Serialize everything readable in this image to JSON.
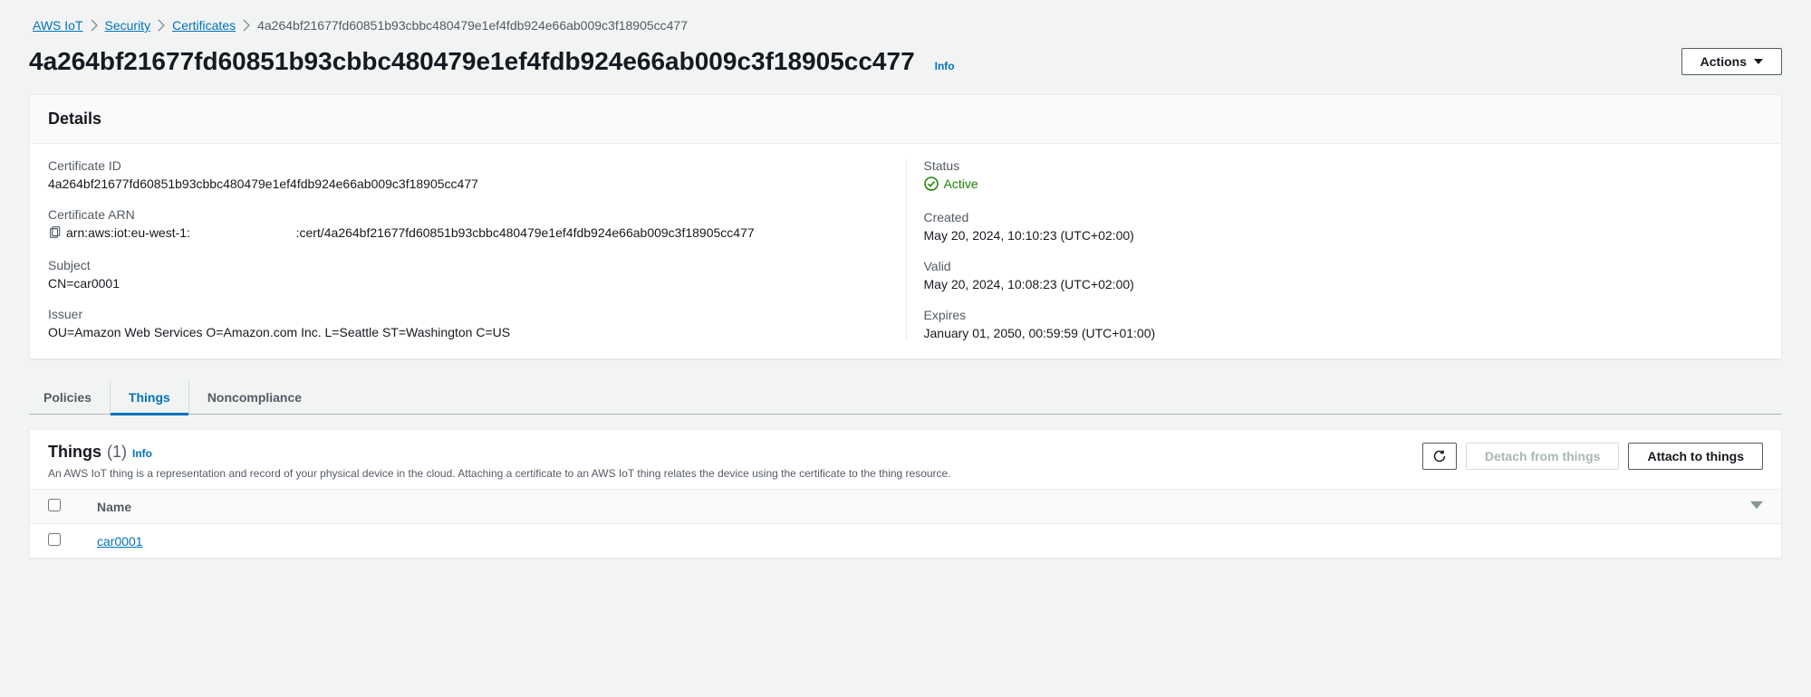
{
  "breadcrumb": {
    "items": [
      {
        "label": "AWS IoT"
      },
      {
        "label": "Security"
      },
      {
        "label": "Certificates"
      }
    ],
    "current": "4a264bf21677fd60851b93cbbc480479e1ef4fdb924e66ab009c3f18905cc477"
  },
  "title": {
    "text": "4a264bf21677fd60851b93cbbc480479e1ef4fdb924e66ab009c3f18905cc477",
    "info_label": "Info",
    "actions_label": "Actions"
  },
  "details": {
    "header": "Details",
    "left": {
      "certificate_id_label": "Certificate ID",
      "certificate_id_value": "4a264bf21677fd60851b93cbbc480479e1ef4fdb924e66ab009c3f18905cc477",
      "certificate_arn_label": "Certificate ARN",
      "certificate_arn_value": "arn:aws:iot:eu-west-1:                              :cert/4a264bf21677fd60851b93cbbc480479e1ef4fdb924e66ab009c3f18905cc477",
      "subject_label": "Subject",
      "subject_value": "CN=car0001",
      "issuer_label": "Issuer",
      "issuer_value": "OU=Amazon Web Services O=Amazon.com Inc. L=Seattle ST=Washington C=US"
    },
    "right": {
      "status_label": "Status",
      "status_value": "Active",
      "created_label": "Created",
      "created_value": "May 20, 2024, 10:10:23 (UTC+02:00)",
      "valid_label": "Valid",
      "valid_value": "May 20, 2024, 10:08:23 (UTC+02:00)",
      "expires_label": "Expires",
      "expires_value": "January 01, 2050, 00:59:59 (UTC+01:00)"
    }
  },
  "tabs": {
    "policies": "Policies",
    "things": "Things",
    "noncompliance": "Noncompliance"
  },
  "things": {
    "title": "Things",
    "count": "(1)",
    "info_label": "Info",
    "description": "An AWS IoT thing is a representation and record of your physical device in the cloud. Attaching a certificate to an AWS IoT thing relates the device using the certificate to the thing resource.",
    "refresh_label": "Refresh",
    "detach_label": "Detach from things",
    "attach_label": "Attach to things",
    "columns": {
      "name": "Name"
    },
    "rows": [
      {
        "name": "car0001"
      }
    ]
  }
}
